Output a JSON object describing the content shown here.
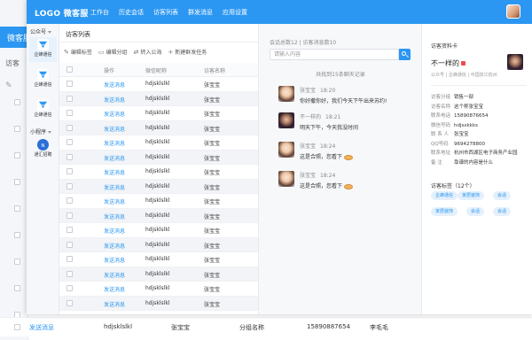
{
  "background_window": {
    "logo": "微客服",
    "sub_title": "访客",
    "row": {
      "action": "发送消息",
      "wx": "hdjsklslkl",
      "name": "张宝宝",
      "group": "分组名称",
      "phone": "15890887654",
      "person": "李毛毛"
    }
  },
  "app": {
    "logo": "LOGO 微客服",
    "nav": [
      "工作台",
      "历史会话",
      "访客列表",
      "群发消息",
      "应用设置"
    ]
  },
  "sidebar": {
    "group1": "公众号",
    "group2": "小程序",
    "items": [
      {
        "label": "企蜂通信",
        "icon": "funnel-icon"
      },
      {
        "label": "企蜂通信",
        "icon": "funnel-icon"
      },
      {
        "label": "企蜂通信",
        "icon": "funnel-icon"
      },
      {
        "label": "通汇招聘",
        "icon": "nr-logo-icon"
      }
    ]
  },
  "visitor_list": {
    "title": "访客列表",
    "toolbar": [
      "编辑标签",
      "编辑分组",
      "转入公海",
      "新建群发任务"
    ],
    "columns": [
      "操作",
      "微信昵称",
      "访客名称"
    ],
    "rows": [
      {
        "action": "发送消息",
        "wx": "hdjsklslkl",
        "name": "张宝宝"
      },
      {
        "action": "发送消息",
        "wx": "hdjsklslkl",
        "name": "张宝宝"
      },
      {
        "action": "发送消息",
        "wx": "hdjsklslkl",
        "name": "张宝宝"
      },
      {
        "action": "发送消息",
        "wx": "hdjsklslkl",
        "name": "张宝宝"
      },
      {
        "action": "发送消息",
        "wx": "hdjsklslkl",
        "name": "张宝宝"
      },
      {
        "action": "发送消息",
        "wx": "hdjsklslkl",
        "name": "张宝宝"
      },
      {
        "action": "发送消息",
        "wx": "hdjsklslkl",
        "name": "张宝宝"
      },
      {
        "action": "发送消息",
        "wx": "hdjsklslkl",
        "name": "张宝宝"
      },
      {
        "action": "发送消息",
        "wx": "hdjsklslkl",
        "name": "张宝宝"
      },
      {
        "action": "发送消息",
        "wx": "hdjsklslkl",
        "name": "张宝宝"
      },
      {
        "action": "发送消息",
        "wx": "hdjsklslkl",
        "name": "张宝宝"
      },
      {
        "action": "发送消息",
        "wx": "hdjsklslkl",
        "name": "张宝宝"
      },
      {
        "action": "发送消息",
        "wx": "hdjsklslkl",
        "name": "张宝宝"
      },
      {
        "action": "发送消息",
        "wx": "hdjsklslkl",
        "name": "张宝宝"
      },
      {
        "action": "发送消息",
        "wx": "hdjsklslkl",
        "name": "张宝宝"
      },
      {
        "action": "发送消息",
        "wx": "hdjsklslkl",
        "name": "张宝宝"
      }
    ]
  },
  "chat": {
    "meta": "会话总数12 | 访客消息数10",
    "search_placeholder": "请输入内容",
    "history_note": "共找到15条聊天记录",
    "messages": [
      {
        "name": "张宝宝",
        "time": "18:20",
        "text": "你好撒你好，我们今天下午出来苏约!",
        "avatar": "girl",
        "emoji": false
      },
      {
        "name": "不一样的",
        "time": "18:21",
        "text": "明天下午，今天我没时间",
        "avatar": "boy",
        "emoji": false
      },
      {
        "name": "张宝宝",
        "time": "18:24",
        "text": "这是合照，您看下",
        "avatar": "girl",
        "emoji": true
      },
      {
        "name": "张宝宝",
        "time": "18:24",
        "text": "这是合照，您看下",
        "avatar": "girl",
        "emoji": true
      }
    ]
  },
  "profile": {
    "title": "访客资料卡",
    "name": "不一样的",
    "org": "公众号 | 企蜂通信 | 中国浙江杭州",
    "fields": [
      {
        "k": "访客分组",
        "v": "销售一部"
      },
      {
        "k": "访客名称",
        "v": "这个称张宝宝"
      },
      {
        "k": "联系电话",
        "v": "15890876654"
      },
      {
        "k": "微信号码",
        "v": "hdjsxkkks"
      },
      {
        "k": "联 系 人",
        "v": "张宝宝"
      },
      {
        "k": "QQ号码",
        "v": "9694278800"
      },
      {
        "k": "联系地址",
        "v": "杭州市西湖区电子商务产业园"
      },
      {
        "k": "备    注",
        "v": "靠谱的内容是什么"
      }
    ],
    "tags_title": "访客标签（12个）",
    "tags": [
      "企蜂通信",
      "家居装饰",
      "会话",
      "家居装饰",
      "会话",
      "会话"
    ]
  },
  "colors": {
    "brand": "#2b97f2",
    "link": "#2b97f2",
    "stripe": "#f2f4f7"
  }
}
